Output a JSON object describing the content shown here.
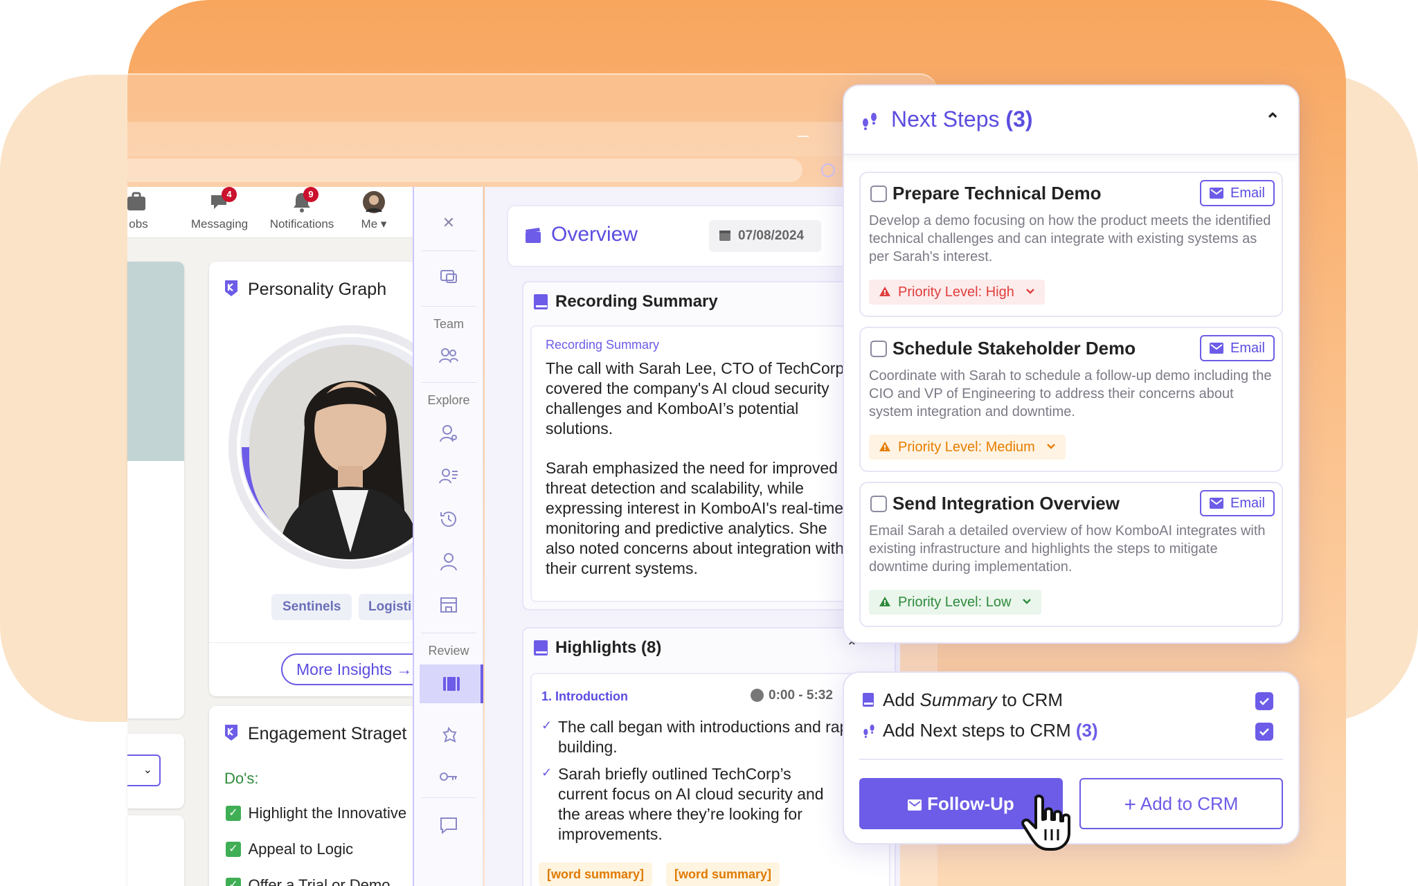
{
  "colors": {
    "accent": "#6c5ce7",
    "high": "#e03e3e",
    "medium": "#e67e00",
    "low": "#2f8a3b",
    "linkedin_badge": "#cb112d"
  },
  "linkedin": {
    "nav": [
      {
        "label": "obs",
        "icon": "briefcase-icon"
      },
      {
        "label": "Messaging",
        "icon": "messaging-icon",
        "badge": "4"
      },
      {
        "label": "Notifications",
        "icon": "bell-icon",
        "badge": "9"
      },
      {
        "label": "Me",
        "icon": "avatar"
      }
    ]
  },
  "personality": {
    "title": "Personality Graph",
    "tags": [
      "Sentinels",
      "Logisti"
    ],
    "more_label": "More Insights"
  },
  "engagement": {
    "title": "Engagement Straget",
    "dos_label": "Do's:",
    "items": [
      "Highlight the Innovative",
      "Appeal to Logic",
      "Offer a Trial or Demo"
    ]
  },
  "rail": {
    "labels": {
      "team": "Team",
      "explore": "Explore",
      "review": "Review"
    }
  },
  "overview": {
    "title": "Overview",
    "date": "07/08/2024",
    "recording": {
      "title": "Recording Summary",
      "subtitle": "Recording Summary",
      "para1": "The call with Sarah Lee, CTO of TechCorp, covered the company's AI cloud security challenges and KomboAI’s potential solutions.",
      "para2": "Sarah emphasized the need for improved threat detection and scalability, while expressing interest in KomboAI's real-time monitoring and predictive analytics. She also noted concerns about integration with their current systems."
    },
    "highlights": {
      "title": "Highlights (8)",
      "section": "1. Introduction",
      "time": "0:00 - 5:32",
      "bullets": [
        "The call began with introductions and rapport-building.",
        "Sarah briefly outlined TechCorp’s current focus on AI cloud security and the areas where they’re looking for improvements."
      ],
      "tags": [
        "[word summary]",
        "[word summary]"
      ]
    }
  },
  "next_steps": {
    "title": "Next Steps",
    "count": "(3)",
    "email_label": "Email",
    "items": [
      {
        "title": "Prepare Technical Demo",
        "desc": "Develop a demo focusing on how the product meets the identified technical challenges and can integrate with existing systems as per Sarah's interest.",
        "priority": "Priority Level: High"
      },
      {
        "title": "Schedule Stakeholder Demo",
        "desc": "Coordinate with Sarah to schedule a follow-up demo including the CIO and VP of Engineering to address their concerns about system integration and downtime.",
        "priority": "Priority Level: Medium"
      },
      {
        "title": "Send Integration Overview",
        "desc": "Email Sarah a detailed overview of how KomboAI integrates with existing infrastructure and highlights the steps to mitigate downtime during implementation.",
        "priority": "Priority Level: Low"
      }
    ]
  },
  "crm": {
    "row1_pre": "Add ",
    "row1_em": "Summary",
    "row1_post": " to CRM",
    "row2": "Add Next steps to CRM ",
    "row2_count": "(3)",
    "follow_up": "Follow-Up",
    "add_crm": "Add to CRM"
  }
}
